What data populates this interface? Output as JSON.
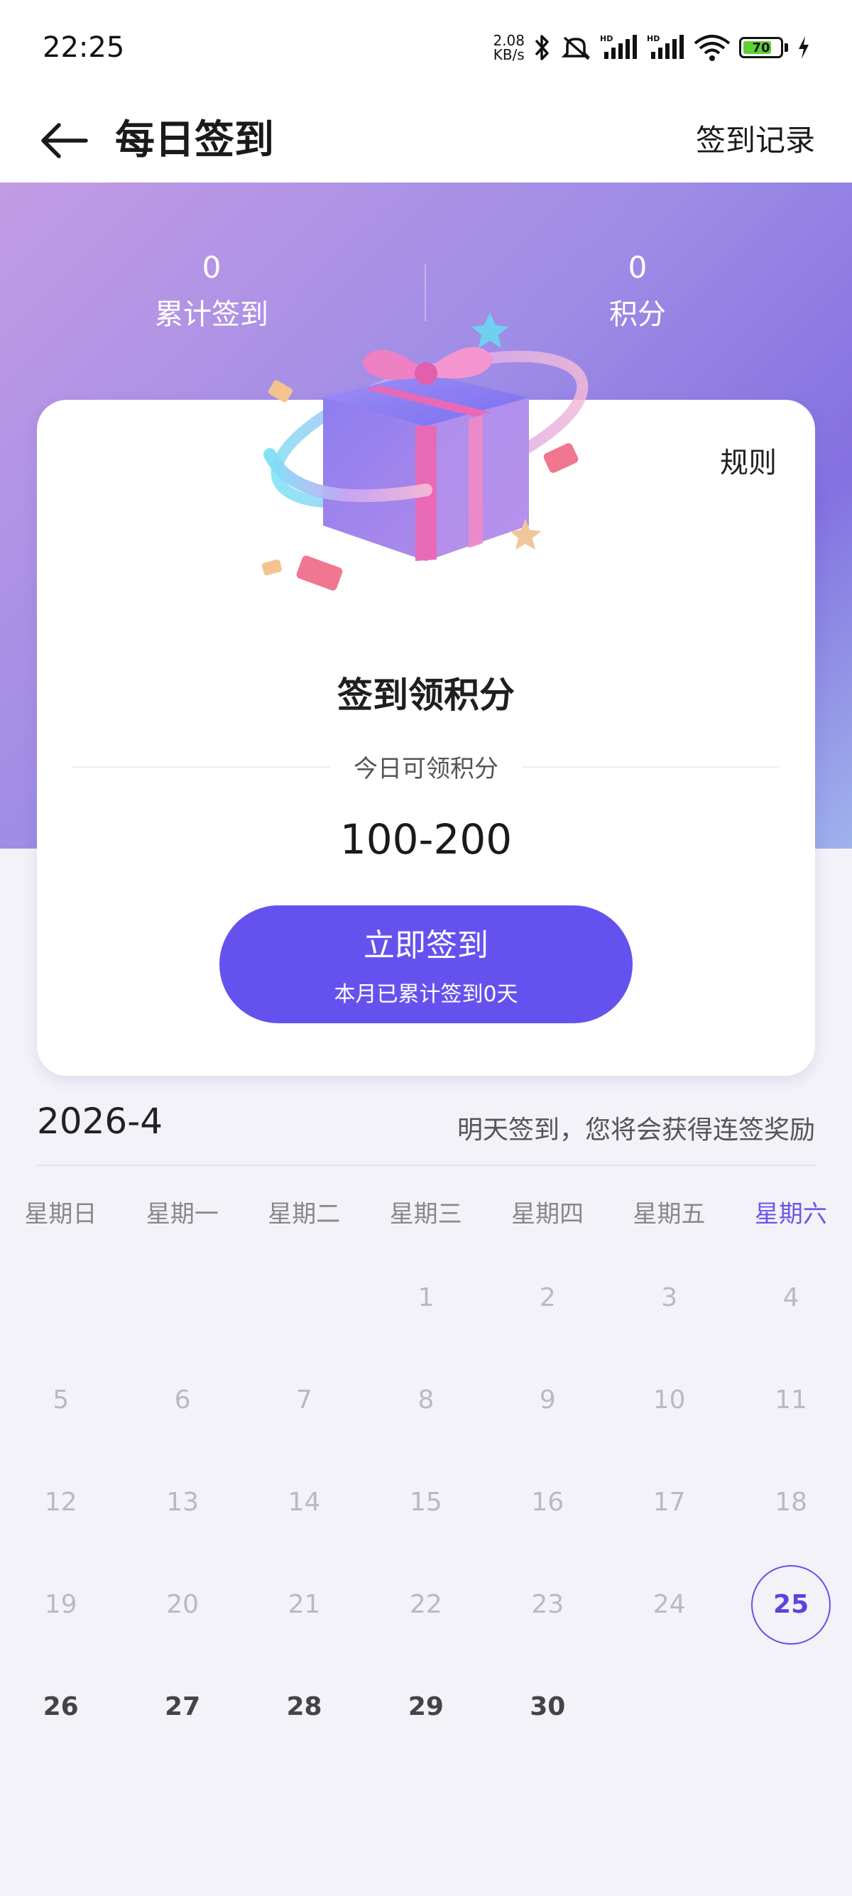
{
  "status_bar": {
    "time": "22:25",
    "net_speed_value": "2.08",
    "net_speed_unit": "KB/s",
    "battery_level": "70",
    "icons": [
      "bluetooth-icon",
      "mute-icon",
      "hd-signal-icon",
      "hd-signal-icon",
      "wifi-icon",
      "battery-icon",
      "charging-icon"
    ]
  },
  "header": {
    "title": "每日签到",
    "record_link": "签到记录"
  },
  "stats": {
    "total_signin_value": "0",
    "total_signin_label": "累计签到",
    "points_value": "0",
    "points_label": "积分"
  },
  "card": {
    "rules_label": "规则",
    "title": "签到领积分",
    "subtitle": "今日可领积分",
    "points_range": "100-200",
    "button_label": "立即签到",
    "button_sub": "本月已累计签到0天"
  },
  "calendar": {
    "month": "2026-4",
    "hint": "明天签到，您将会获得连签奖励",
    "weekdays": [
      "星期日",
      "星期一",
      "星期二",
      "星期三",
      "星期四",
      "星期五",
      "星期六"
    ],
    "today": 25,
    "days": [
      "1",
      "2",
      "3",
      "4",
      "5",
      "6",
      "7",
      "8",
      "9",
      "10",
      "11",
      "12",
      "13",
      "14",
      "15",
      "16",
      "17",
      "18",
      "19",
      "20",
      "21",
      "22",
      "23",
      "24",
      "25",
      "26",
      "27",
      "28",
      "29",
      "30"
    ]
  },
  "colors": {
    "accent": "#6552ee",
    "hero_start": "#c39be4",
    "hero_end": "#8471e0"
  }
}
